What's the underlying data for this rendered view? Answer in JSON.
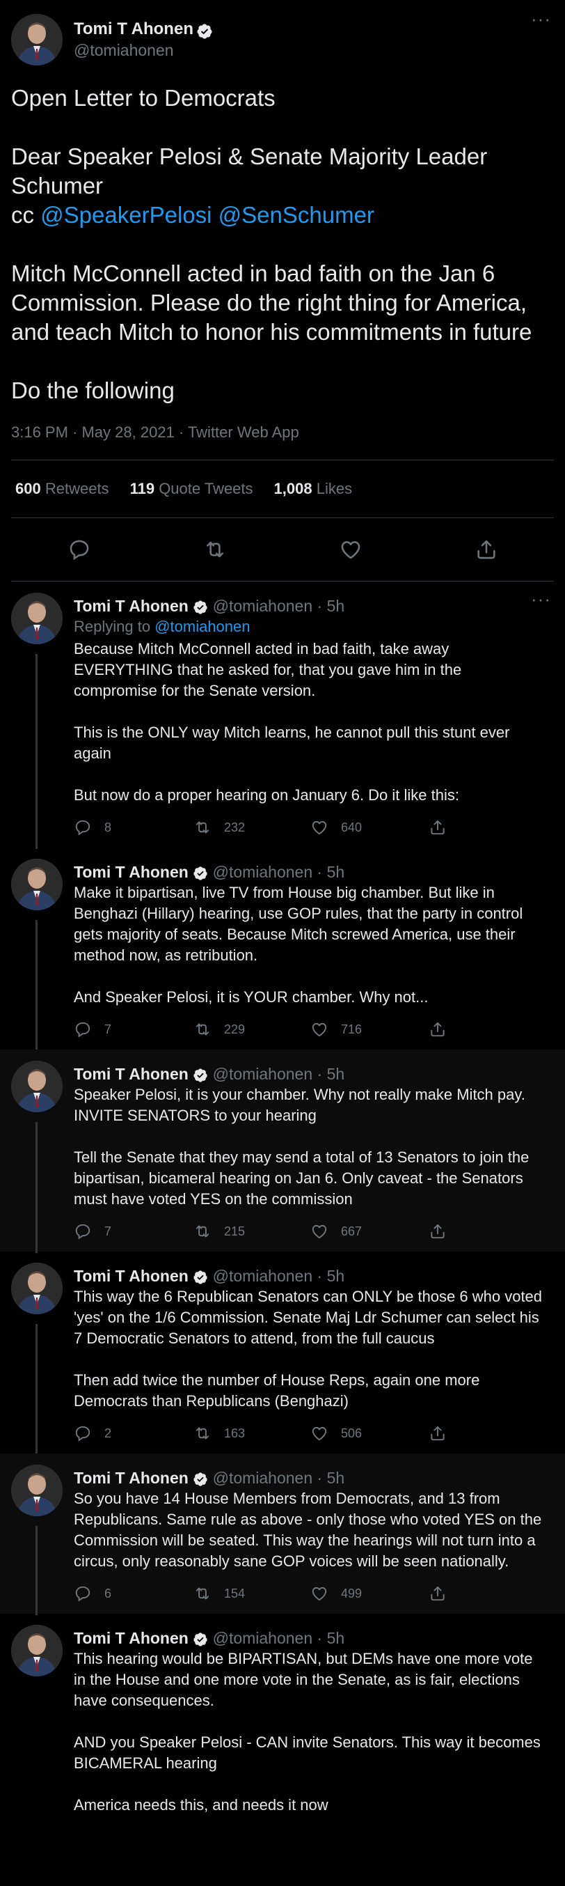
{
  "main_tweet": {
    "name": "Tomi T Ahonen",
    "handle": "@tomiahonen",
    "more": "···",
    "text_1": "Open Letter to Democrats\n\nDear Speaker Pelosi & Senate Majority Leader Schumer",
    "text_cc": "cc ",
    "mention_1": "@SpeakerPelosi",
    "mention_2": "@SenSchumer",
    "text_2": "Mitch McConnell acted in bad faith on the Jan 6 Commission. Please do the right thing for America, and teach Mitch to honor his commitments in future\n\nDo the following",
    "timestamp": "3:16 PM · May 28, 2021 · Twitter Web App",
    "retweets_count": "600",
    "retweets_label": "Retweets",
    "quotes_count": "119",
    "quotes_label": "Quote Tweets",
    "likes_count": "1,008",
    "likes_label": "Likes"
  },
  "replies": [
    {
      "name": "Tomi T Ahonen",
      "meta": "@tomiahonen · 5h",
      "replying_prefix": "Replying to ",
      "replying_handle": "@tomiahonen",
      "text": "Because Mitch McConnell acted in bad faith, take away EVERYTHING that he asked for, that you gave him in the compromise for the Senate version.\n\nThis is the ONLY way Mitch learns, he cannot pull this stunt ever again\n\nBut now do a proper hearing on January 6. Do it like this:",
      "replies": "8",
      "retweets": "232",
      "likes": "640"
    },
    {
      "name": "Tomi T Ahonen",
      "meta": "@tomiahonen · 5h",
      "text": "Make it bipartisan, live TV from House big chamber. But like in Benghazi (Hillary) hearing, use GOP rules, that the party in control gets majority of seats. Because Mitch screwed America, use their method now, as retribution.\n\nAnd Speaker Pelosi, it is YOUR chamber. Why not...",
      "replies": "7",
      "retweets": "229",
      "likes": "716"
    },
    {
      "name": "Tomi T Ahonen",
      "meta": "@tomiahonen · 5h",
      "text": "Speaker Pelosi, it is your chamber. Why not really make Mitch pay. INVITE SENATORS to your hearing\n\nTell the Senate that they may send a total of 13 Senators to join the bipartisan, bicameral hearing on Jan 6. Only caveat - the Senators must have voted YES on the commission",
      "replies": "7",
      "retweets": "215",
      "likes": "667"
    },
    {
      "name": "Tomi T Ahonen",
      "meta": "@tomiahonen · 5h",
      "text": "This way the 6 Republican Senators can ONLY be those 6 who voted 'yes' on the 1/6 Commission. Senate Maj Ldr Schumer can select his 7 Democratic Senators to attend, from the full caucus\n\nThen add twice the number of House Reps, again one more Democrats than Republicans (Benghazi)",
      "replies": "2",
      "retweets": "163",
      "likes": "506"
    },
    {
      "name": "Tomi T Ahonen",
      "meta": "@tomiahonen · 5h",
      "text": "So you have 14 House Members from Democrats, and 13 from Republicans. Same rule as above - only those who voted YES on the Commission will be seated. This way the hearings will not turn into a circus, only reasonably sane GOP voices will be seen nationally.",
      "replies": "6",
      "retweets": "154",
      "likes": "499"
    },
    {
      "name": "Tomi T Ahonen",
      "meta": "@tomiahonen · 5h",
      "text": "This hearing would be BIPARTISAN, but DEMs have one more vote in the House and one more vote in the Senate, as is fair, elections have consequences.\n\nAND you Speaker Pelosi - CAN invite Senators. This way it becomes BICAMERAL hearing\n\nAmerica needs this, and needs it now",
      "replies": "",
      "retweets": "",
      "likes": ""
    }
  ]
}
